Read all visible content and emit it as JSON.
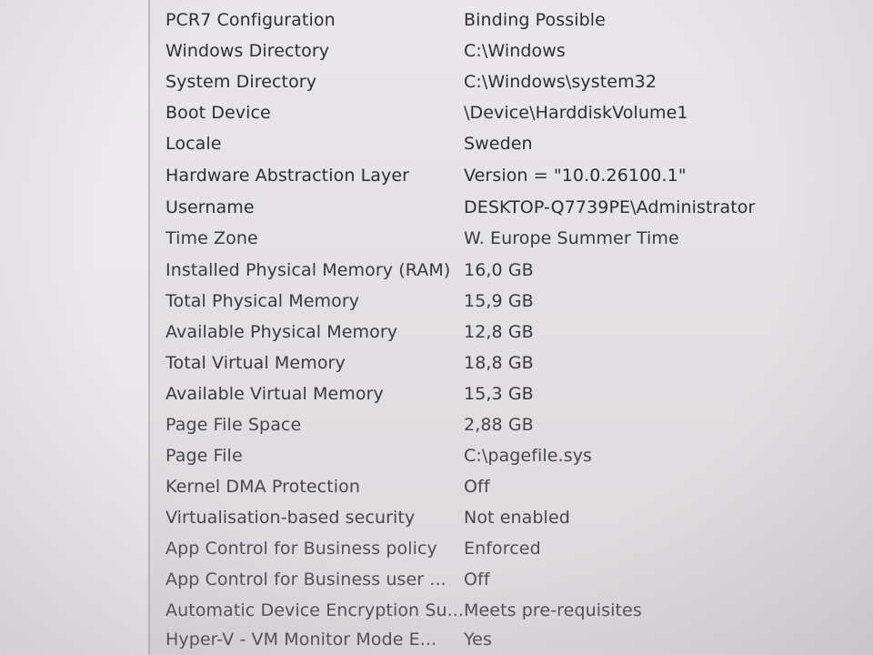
{
  "system_summary": {
    "rows": [
      {
        "item": "PCR7 Configuration",
        "value": "Binding Possible"
      },
      {
        "item": "Windows Directory",
        "value": "C:\\Windows"
      },
      {
        "item": "System Directory",
        "value": "C:\\Windows\\system32"
      },
      {
        "item": "Boot Device",
        "value": "\\Device\\HarddiskVolume1"
      },
      {
        "item": "Locale",
        "value": "Sweden"
      },
      {
        "item": "Hardware Abstraction Layer",
        "value": "Version = \"10.0.26100.1\""
      },
      {
        "item": "Username",
        "value": "DESKTOP-Q7739PE\\Administrator"
      },
      {
        "item": "Time Zone",
        "value": "W. Europe Summer Time"
      },
      {
        "item": "Installed Physical Memory (RAM)",
        "value": "16,0 GB"
      },
      {
        "item": "Total Physical Memory",
        "value": "15,9 GB"
      },
      {
        "item": "Available Physical Memory",
        "value": "12,8 GB"
      },
      {
        "item": "Total Virtual Memory",
        "value": "18,8 GB"
      },
      {
        "item": "Available Virtual Memory",
        "value": "15,3 GB"
      },
      {
        "item": "Page File Space",
        "value": "2,88 GB"
      },
      {
        "item": "Page File",
        "value": "C:\\pagefile.sys"
      },
      {
        "item": "Kernel DMA Protection",
        "value": "Off"
      },
      {
        "item": "Virtualisation-based security",
        "value": "Not enabled"
      },
      {
        "item": "App Control for Business policy",
        "value": "Enforced"
      },
      {
        "item": "App Control for Business user ...",
        "value": "Off"
      },
      {
        "item": "Automatic Device Encryption Su...",
        "value": "Meets pre-requisites"
      },
      {
        "item": "Hyper-V - VM Monitor Mode E...",
        "value": "Yes"
      }
    ]
  }
}
